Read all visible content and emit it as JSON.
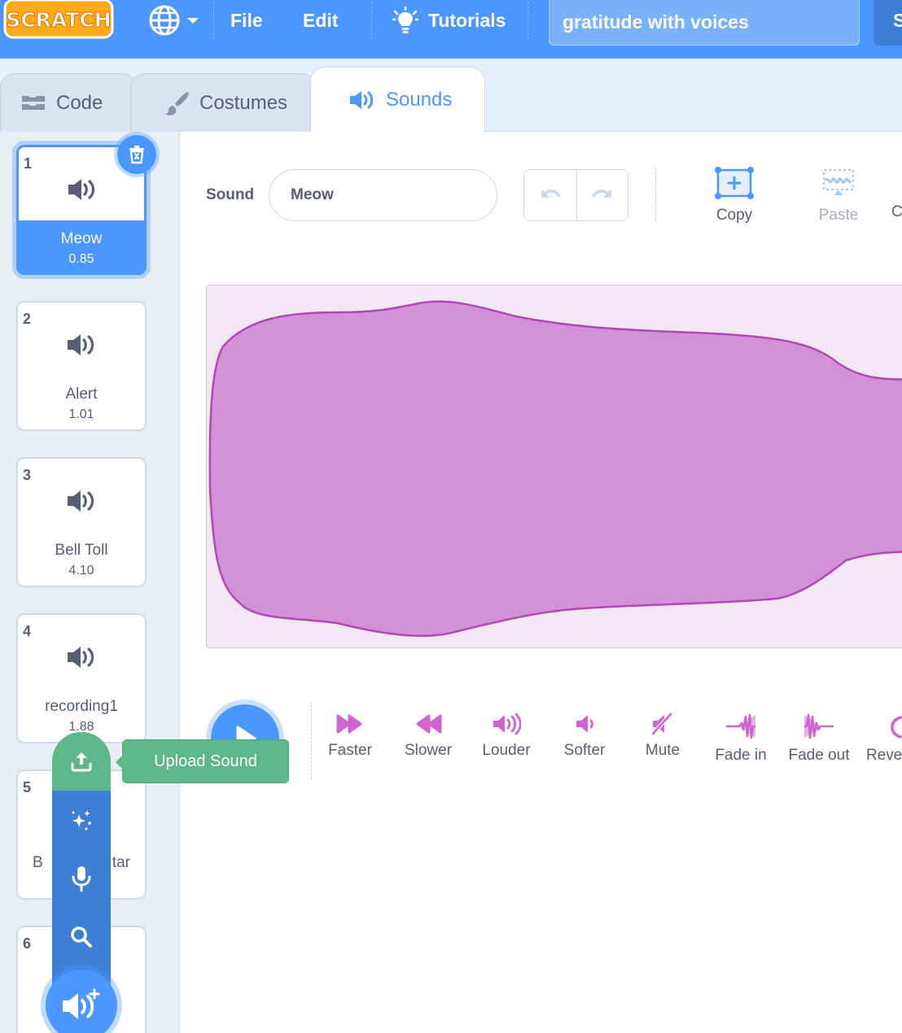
{
  "menubar": {
    "logo_text": "SCRATCH",
    "file_label": "File",
    "edit_label": "Edit",
    "tutorials_label": "Tutorials",
    "project_title": "gratitude with voices",
    "share_label": "S"
  },
  "tabs": {
    "code": "Code",
    "costumes": "Costumes",
    "sounds": "Sounds"
  },
  "sounds": [
    {
      "number": "1",
      "name": "Meow",
      "duration": "0.85",
      "selected": true
    },
    {
      "number": "2",
      "name": "Alert",
      "duration": "1.01"
    },
    {
      "number": "3",
      "name": "Bell Toll",
      "duration": "4.10"
    },
    {
      "number": "4",
      "name": "recording1",
      "duration": "1.88"
    },
    {
      "number": "5",
      "name": "B",
      "name_tail": "tar",
      "duration": ""
    },
    {
      "number": "6",
      "name": "",
      "duration": ""
    }
  ],
  "add_menu": {
    "upload_tooltip": "Upload Sound",
    "items": [
      "upload-icon",
      "surprise-icon",
      "microphone-icon",
      "search-icon"
    ]
  },
  "editor": {
    "sound_label": "Sound",
    "sound_name": "Meow",
    "copy_label": "Copy",
    "paste_label": "Paste",
    "copy_new_label": "C",
    "wave_color": "#cf63cf"
  },
  "effects": [
    "Faster",
    "Slower",
    "Louder",
    "Softer",
    "Mute",
    "Fade in",
    "Fade out",
    "Reve"
  ],
  "colors": {
    "primary": "#4c97ff",
    "upload_green": "#5cb987",
    "sound_purple": "#cf63cf"
  }
}
